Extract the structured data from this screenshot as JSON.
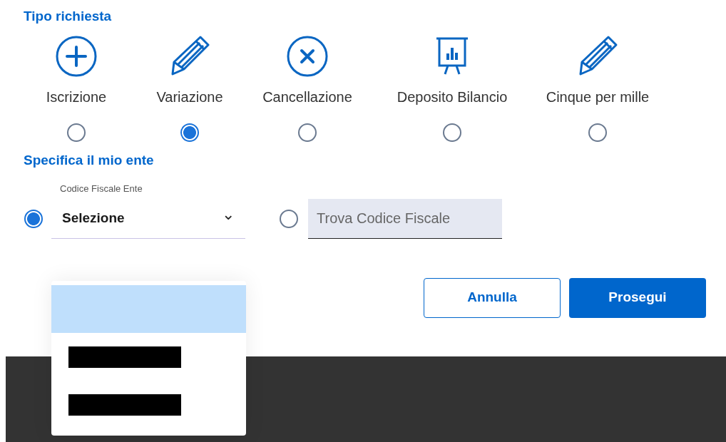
{
  "request_type": {
    "heading": "Tipo richiesta",
    "options": [
      {
        "label": "Iscrizione",
        "selected": false
      },
      {
        "label": "Variazione",
        "selected": true
      },
      {
        "label": "Cancellazione",
        "selected": false
      },
      {
        "label": "Deposito Bilancio",
        "selected": false
      },
      {
        "label": "Cinque per mille",
        "selected": false
      }
    ]
  },
  "entity": {
    "heading": "Specifica il mio ente",
    "select_mode": {
      "selected": true,
      "label": "Codice Fiscale Ente",
      "value": "Selezione",
      "caret": "⌄"
    },
    "search_mode": {
      "selected": false,
      "placeholder": "Trova Codice Fiscale"
    },
    "dropdown": {
      "open": true,
      "options": [
        {
          "kind": "empty",
          "selected": true
        },
        {
          "kind": "redacted",
          "selected": false
        },
        {
          "kind": "redacted",
          "selected": false
        }
      ]
    }
  },
  "buttons": [
    {
      "label": "Annulla",
      "kind": "secondary"
    },
    {
      "label": "Prosegui",
      "kind": "primary"
    }
  ]
}
